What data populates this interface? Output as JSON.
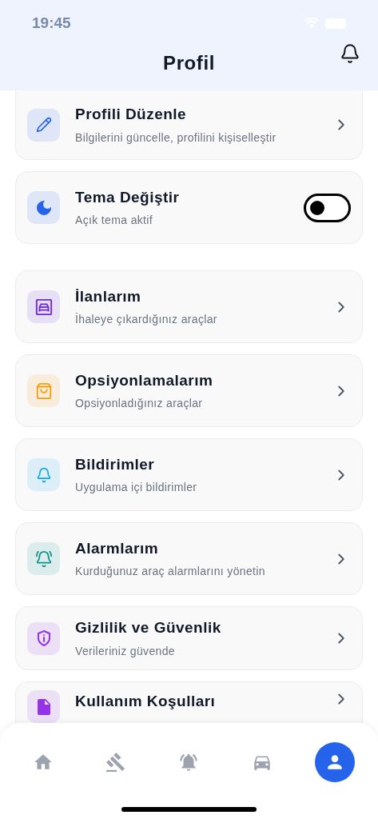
{
  "status_bar": {
    "time": "19:45"
  },
  "header": {
    "title": "Profil"
  },
  "items": [
    {
      "kind": "link",
      "title": "Profili Düzenle",
      "subtitle": "Bilgilerini güncelle, profilini kişiselleştir",
      "color": "#2563eb"
    },
    {
      "kind": "toggle",
      "title": "Tema Değiştir",
      "subtitle": "Açık tema aktif",
      "on": false,
      "color": "#2563eb"
    },
    {
      "kind": "link",
      "title": "İlanlarım",
      "subtitle": "İhaleye çıkardığınız araçlar",
      "color": "#6d28d9"
    },
    {
      "kind": "link",
      "title": "Opsiyonlamalarım",
      "subtitle": "Opsiyonladığınız araçlar",
      "color": "#f59e0b"
    },
    {
      "kind": "link",
      "title": "Bildirimler",
      "subtitle": "Uygulama içi bildirimler",
      "color": "#0ea5e9"
    },
    {
      "kind": "link",
      "title": "Alarmlarım",
      "subtitle": "Kurduğunuz araç alarmlarını yönetin",
      "color": "#0d9488"
    },
    {
      "kind": "link",
      "title": "Gizlilik ve Güvenlik",
      "subtitle": "Verileriniz güvende",
      "color": "#9333ea"
    },
    {
      "kind": "link",
      "title": "Kullanım Koşulları",
      "color": "#9333ea"
    }
  ],
  "tab_bar": [
    {
      "selected": false
    },
    {
      "selected": false
    },
    {
      "selected": false
    },
    {
      "selected": false
    },
    {
      "selected": true
    }
  ]
}
